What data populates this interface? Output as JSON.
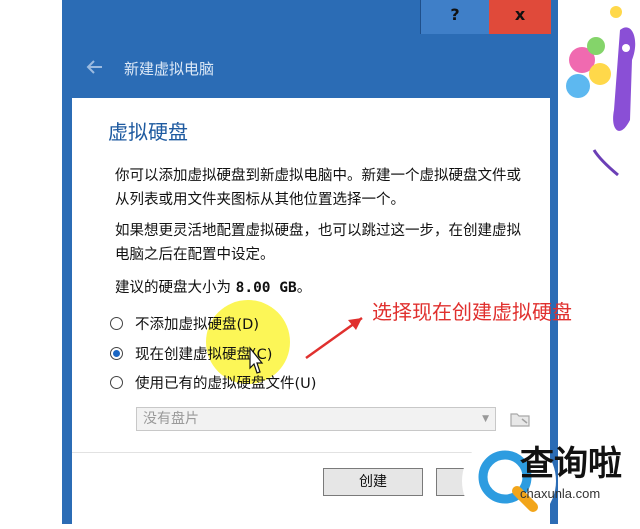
{
  "window": {
    "help_label": "?",
    "close_label": "x",
    "nav_title": "新建虚拟电脑"
  },
  "page": {
    "heading": "虚拟硬盘",
    "para1": "你可以添加虚拟硬盘到新虚拟电脑中。新建一个虚拟硬盘文件或从列表或用文件夹图标从其他位置选择一个。",
    "para2": "如果想更灵活地配置虚拟硬盘，也可以跳过这一步，在创建虚拟电脑之后在配置中设定。",
    "suggest_prefix": "建议的硬盘大小为",
    "suggest_size": "8.00 GB",
    "suggest_suffix": "。"
  },
  "options": [
    {
      "label": "不添加虚拟硬盘(D)",
      "selected": false
    },
    {
      "label": "现在创建虚拟硬盘(C)",
      "selected": true
    },
    {
      "label": "使用已有的虚拟硬盘文件(U)",
      "selected": false
    }
  ],
  "disk_select": {
    "value": "没有盘片"
  },
  "buttons": {
    "create_label": "创建",
    "cancel_label": ""
  },
  "annotation": {
    "text": "选择现在创建虚拟硬盘",
    "color": "#e0302e"
  },
  "watermark": {
    "brand": "查询啦",
    "domain": "chaxunla.com"
  },
  "colors": {
    "frame_blue": "#2b6cb5",
    "heading_blue": "#1e5aa0",
    "close_red": "#e04a3a",
    "highlight_yellow": "#fbf43a"
  }
}
